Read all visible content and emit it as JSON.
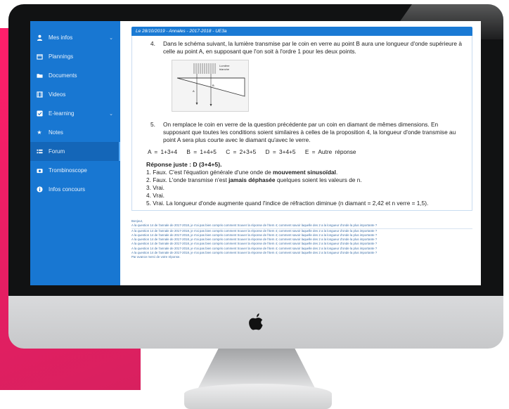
{
  "sidebar": {
    "items": [
      {
        "label": "Mes infos",
        "icon": "user-icon",
        "chevron": "⌄"
      },
      {
        "label": "Plannings",
        "icon": "calendar-icon"
      },
      {
        "label": "Documents",
        "icon": "folder-icon"
      },
      {
        "label": "Videos",
        "icon": "film-icon"
      },
      {
        "label": "E-learning",
        "icon": "checkbox-icon",
        "chevron": "⌄"
      },
      {
        "label": "Notes",
        "icon": "star-icon"
      },
      {
        "label": "Forum",
        "icon": "forum-icon",
        "active": true
      },
      {
        "label": "Trombinoscope",
        "icon": "camera-icon"
      },
      {
        "label": "Infos concours",
        "icon": "info-icon"
      }
    ]
  },
  "post": {
    "header": "Le 28/10/2019 - Annales - 2017-2018 - UE3a",
    "q4": {
      "num": "4.",
      "text": "Dans le schéma suivant, la lumière transmise par le coin en verre au point B aura une longueur d'onde supérieure à celle au point A, en supposant que l'on soit à l'ordre 1 pour les deux points."
    },
    "figure": {
      "label_line1": "Lumière",
      "label_line2": "blanche",
      "point_a": "A",
      "point_b": "B"
    },
    "q5": {
      "num": "5.",
      "text": "On remplace le coin en verre de la question précédente par un coin en diamant de mêmes dimensions. En supposant que toutes les conditions soient similaires à celles de la proposition 4, la longueur d'onde transmise au point A sera plus courte avec le diamant qu'avec le verre."
    },
    "answers": [
      "A = 1+3+4",
      "B = 1+4+5",
      "C = 2+3+5",
      "D = 3+4+5",
      "E = Autre réponse"
    ],
    "explanation": {
      "title": "Réponse juste : D (3+4+5).",
      "l1_pre": "1. Faux. C'est l'équation générale d'une onde de ",
      "l1_bold": "mouvement sinusoïdal",
      "l1_post": ".",
      "l2_pre": "2. Faux. L'onde transmise n'est ",
      "l2_bold": "jamais déphasée",
      "l2_post": " quelques soient les valeurs de n.",
      "l3": "3. Vrai.",
      "l4": "4. Vrai.",
      "l5": "5. Vrai. La longueur d'onde augmente quand l'indice de réfraction diminue (n diamant = 2,42 et n verre = 1,5)."
    },
    "comments": {
      "greeting": "Bonjour,",
      "line": "A la question 14 de l'annale de 2017-2018, je n'ai pas bien compris comment trouver la réponse de l'item 4; comment savoir laquelle des 2 a la longueur d'onde la plus importante ?",
      "closing": "Par avance merci de votre réponse."
    }
  }
}
